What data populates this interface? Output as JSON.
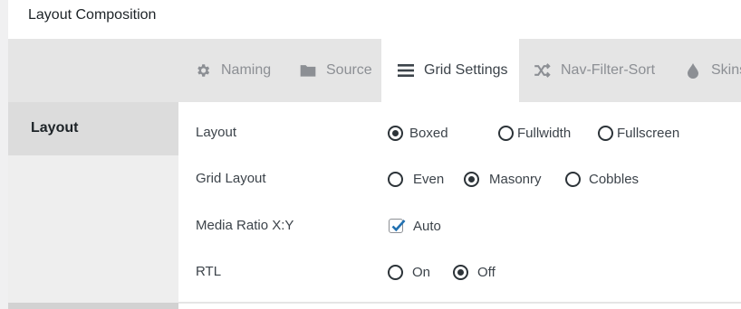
{
  "panel": {
    "title": "Layout Composition"
  },
  "tabs": [
    {
      "label": "Naming",
      "icon": "gear-icon",
      "active": false
    },
    {
      "label": "Source",
      "icon": "folder-icon",
      "active": false
    },
    {
      "label": "Grid Settings",
      "icon": "bars-icon",
      "active": true
    },
    {
      "label": "Nav-Filter-Sort",
      "icon": "shuffle-icon",
      "active": false
    },
    {
      "label": "Skins",
      "icon": "droplet-icon",
      "active": false
    }
  ],
  "sidebar": {
    "items": [
      {
        "label": "Layout",
        "active": true
      }
    ]
  },
  "settings": {
    "layout": {
      "label": "Layout",
      "options": [
        "Boxed",
        "Fullwidth",
        "Fullscreen"
      ],
      "selected": "Boxed"
    },
    "grid_layout": {
      "label": "Grid Layout",
      "options": [
        "Even",
        "Masonry",
        "Cobbles"
      ],
      "selected": "Masonry"
    },
    "media_ratio": {
      "label": "Media Ratio X:Y",
      "checkbox_label": "Auto",
      "checked": true
    },
    "rtl": {
      "label": "RTL",
      "options": [
        "On",
        "Off"
      ],
      "selected": "Off"
    }
  },
  "colors": {
    "accent": "#2271b1",
    "tab_bar": "#e5e5e5",
    "sidebar_active": "#dcdcdc"
  }
}
